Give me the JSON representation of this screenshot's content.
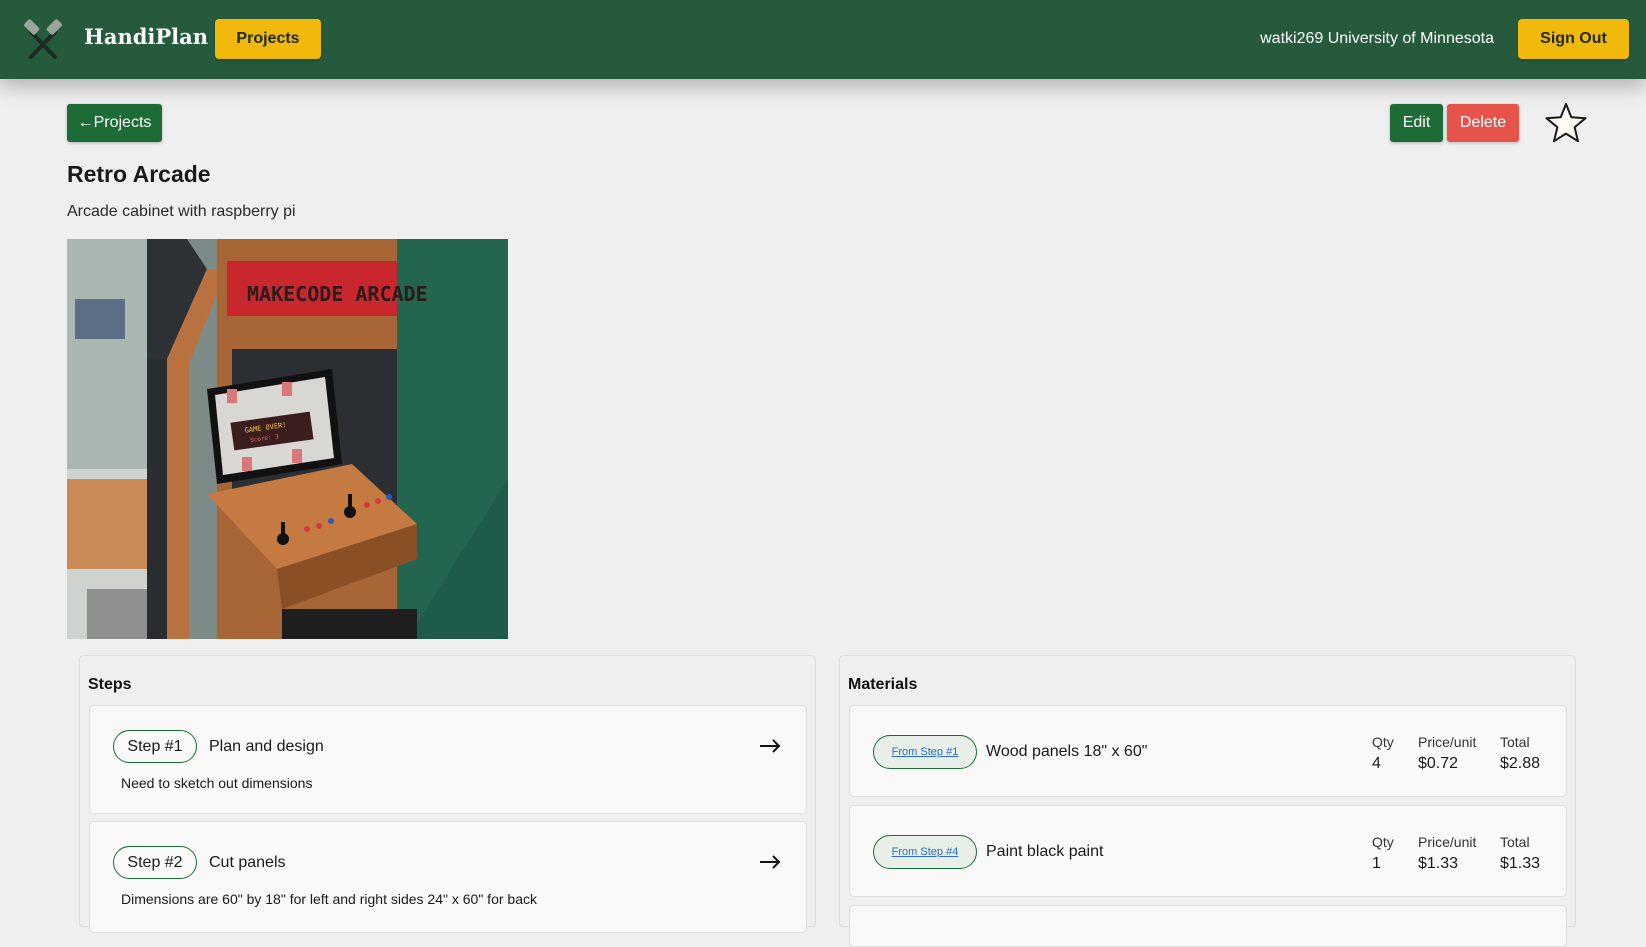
{
  "header": {
    "brand": "HandiPlan",
    "projects_label": "Projects",
    "user": "watki269 University of Minnesota",
    "signout_label": "Sign Out",
    "colors": {
      "bar": "#255a3c",
      "accent": "#f0b90b"
    }
  },
  "toolbar": {
    "back_label": "←Projects",
    "edit_label": "Edit",
    "delete_label": "Delete",
    "favorite_icon": "star-outline-icon"
  },
  "project": {
    "title": "Retro Arcade",
    "description": "Arcade cabinet with raspberry pi",
    "image_marquee": "MAKECODE ARCADE",
    "image_screen_text": "GAME OVER!",
    "image_score_text": "Score: 3"
  },
  "steps": {
    "title": "Steps",
    "items": [
      {
        "pill": "Step #1",
        "title": "Plan and design",
        "desc": "Need to sketch out dimensions"
      },
      {
        "pill": "Step #2",
        "title": "Cut panels",
        "desc": "Dimensions are 60\" by 18\" for left and right sides 24\" x 60\" for back"
      }
    ]
  },
  "materials": {
    "title": "Materials",
    "labels": {
      "qty": "Qty",
      "price": "Price/unit",
      "total": "Total"
    },
    "items": [
      {
        "pill": "From Step #1",
        "name": "Wood panels  18\" x 60\"",
        "qty": "4",
        "price": "$0.72",
        "total": "$2.88"
      },
      {
        "pill": "From Step #4",
        "name": "Paint  black paint",
        "qty": "1",
        "price": "$1.33",
        "total": "$1.33"
      }
    ]
  }
}
